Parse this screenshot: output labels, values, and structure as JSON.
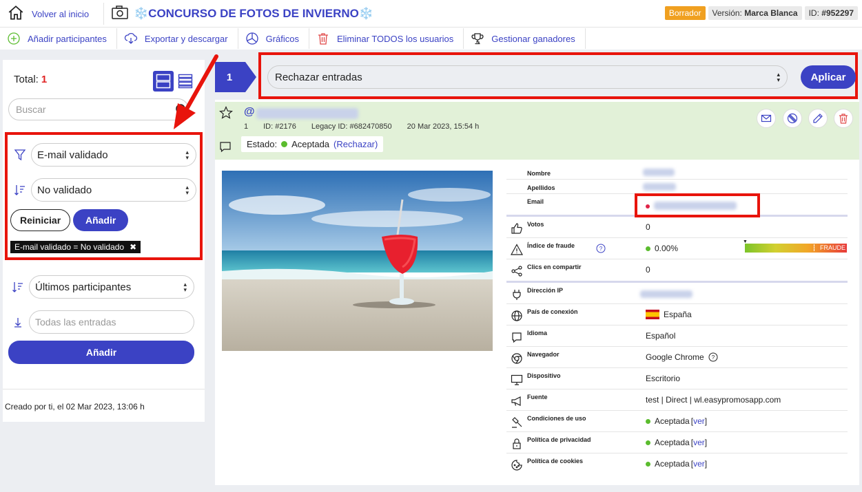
{
  "header": {
    "home_label": "Volver al inicio",
    "title_prefix": "❄️",
    "title": "CONCURSO DE FOTOS DE INVIERNO",
    "title_suffix": "❄️",
    "status_badge": "Borrador",
    "version_label": "Versión:",
    "version_value": "Marca Blanca",
    "id_label": "ID:",
    "id_value": "#952297"
  },
  "toolbar": {
    "add": "Añadir participantes",
    "export": "Exportar y descargar",
    "charts": "Gráficos",
    "delete_all": "Eliminar TODOS los usuarios",
    "winners": "Gestionar ganadores"
  },
  "sidebar": {
    "total_label": "Total:",
    "total_value": "1",
    "search_placeholder": "Buscar",
    "filter_field": "E-mail validado",
    "filter_value": "No validado",
    "reset": "Reiniciar",
    "add": "Añadir",
    "active_filter": "E-mail validado = No validado",
    "sort_by": "Últimos participantes",
    "entries_placeholder": "Todas las entradas",
    "add2": "Añadir",
    "created": "Creado por ti, el 02 Mar 2023, 13:06 h"
  },
  "actions": {
    "step": "1",
    "selected": "Rechazar entradas",
    "apply": "Aplicar"
  },
  "entry": {
    "at": "@",
    "number": "1",
    "id": "ID: #2176",
    "legacy_id": "Legacy ID: #682470850",
    "date": "20 Mar 2023, 15:54 h",
    "estado_label": "Estado:",
    "estado_value": "Aceptada",
    "estado_action": "(Rechazar)"
  },
  "details": {
    "nombre": "Nombre",
    "apellidos": "Apellidos",
    "email": "Email",
    "votos_label": "Votos",
    "votos_value": "0",
    "fraude_label": "Índice de fraude",
    "fraude_value": "0.00%",
    "fraude_tag": "FRAUDE",
    "clics_label": "Clics en compartir",
    "clics_value": "0",
    "ip_label": "Dirección IP",
    "pais_label": "País de conexión",
    "pais_value": "España",
    "idioma_label": "Idioma",
    "idioma_value": "Español",
    "navegador_label": "Navegador",
    "navegador_value": "Google Chrome",
    "dispositivo_label": "Dispositivo",
    "dispositivo_value": "Escritorio",
    "fuente_label": "Fuente",
    "fuente_value": "test | Direct | wl.easypromosapp.com",
    "cond_label": "Condiciones de uso",
    "priv_label": "Política de privacidad",
    "cookies_label": "Política de cookies",
    "accepted": "Aceptada",
    "ver_open": "[",
    "ver": "ver",
    "ver_close": "]"
  },
  "colors": {
    "accent": "#3b42c4",
    "highlight": "#e8140c",
    "draft": "#f0a020",
    "accepted": "#5bbc2e"
  }
}
